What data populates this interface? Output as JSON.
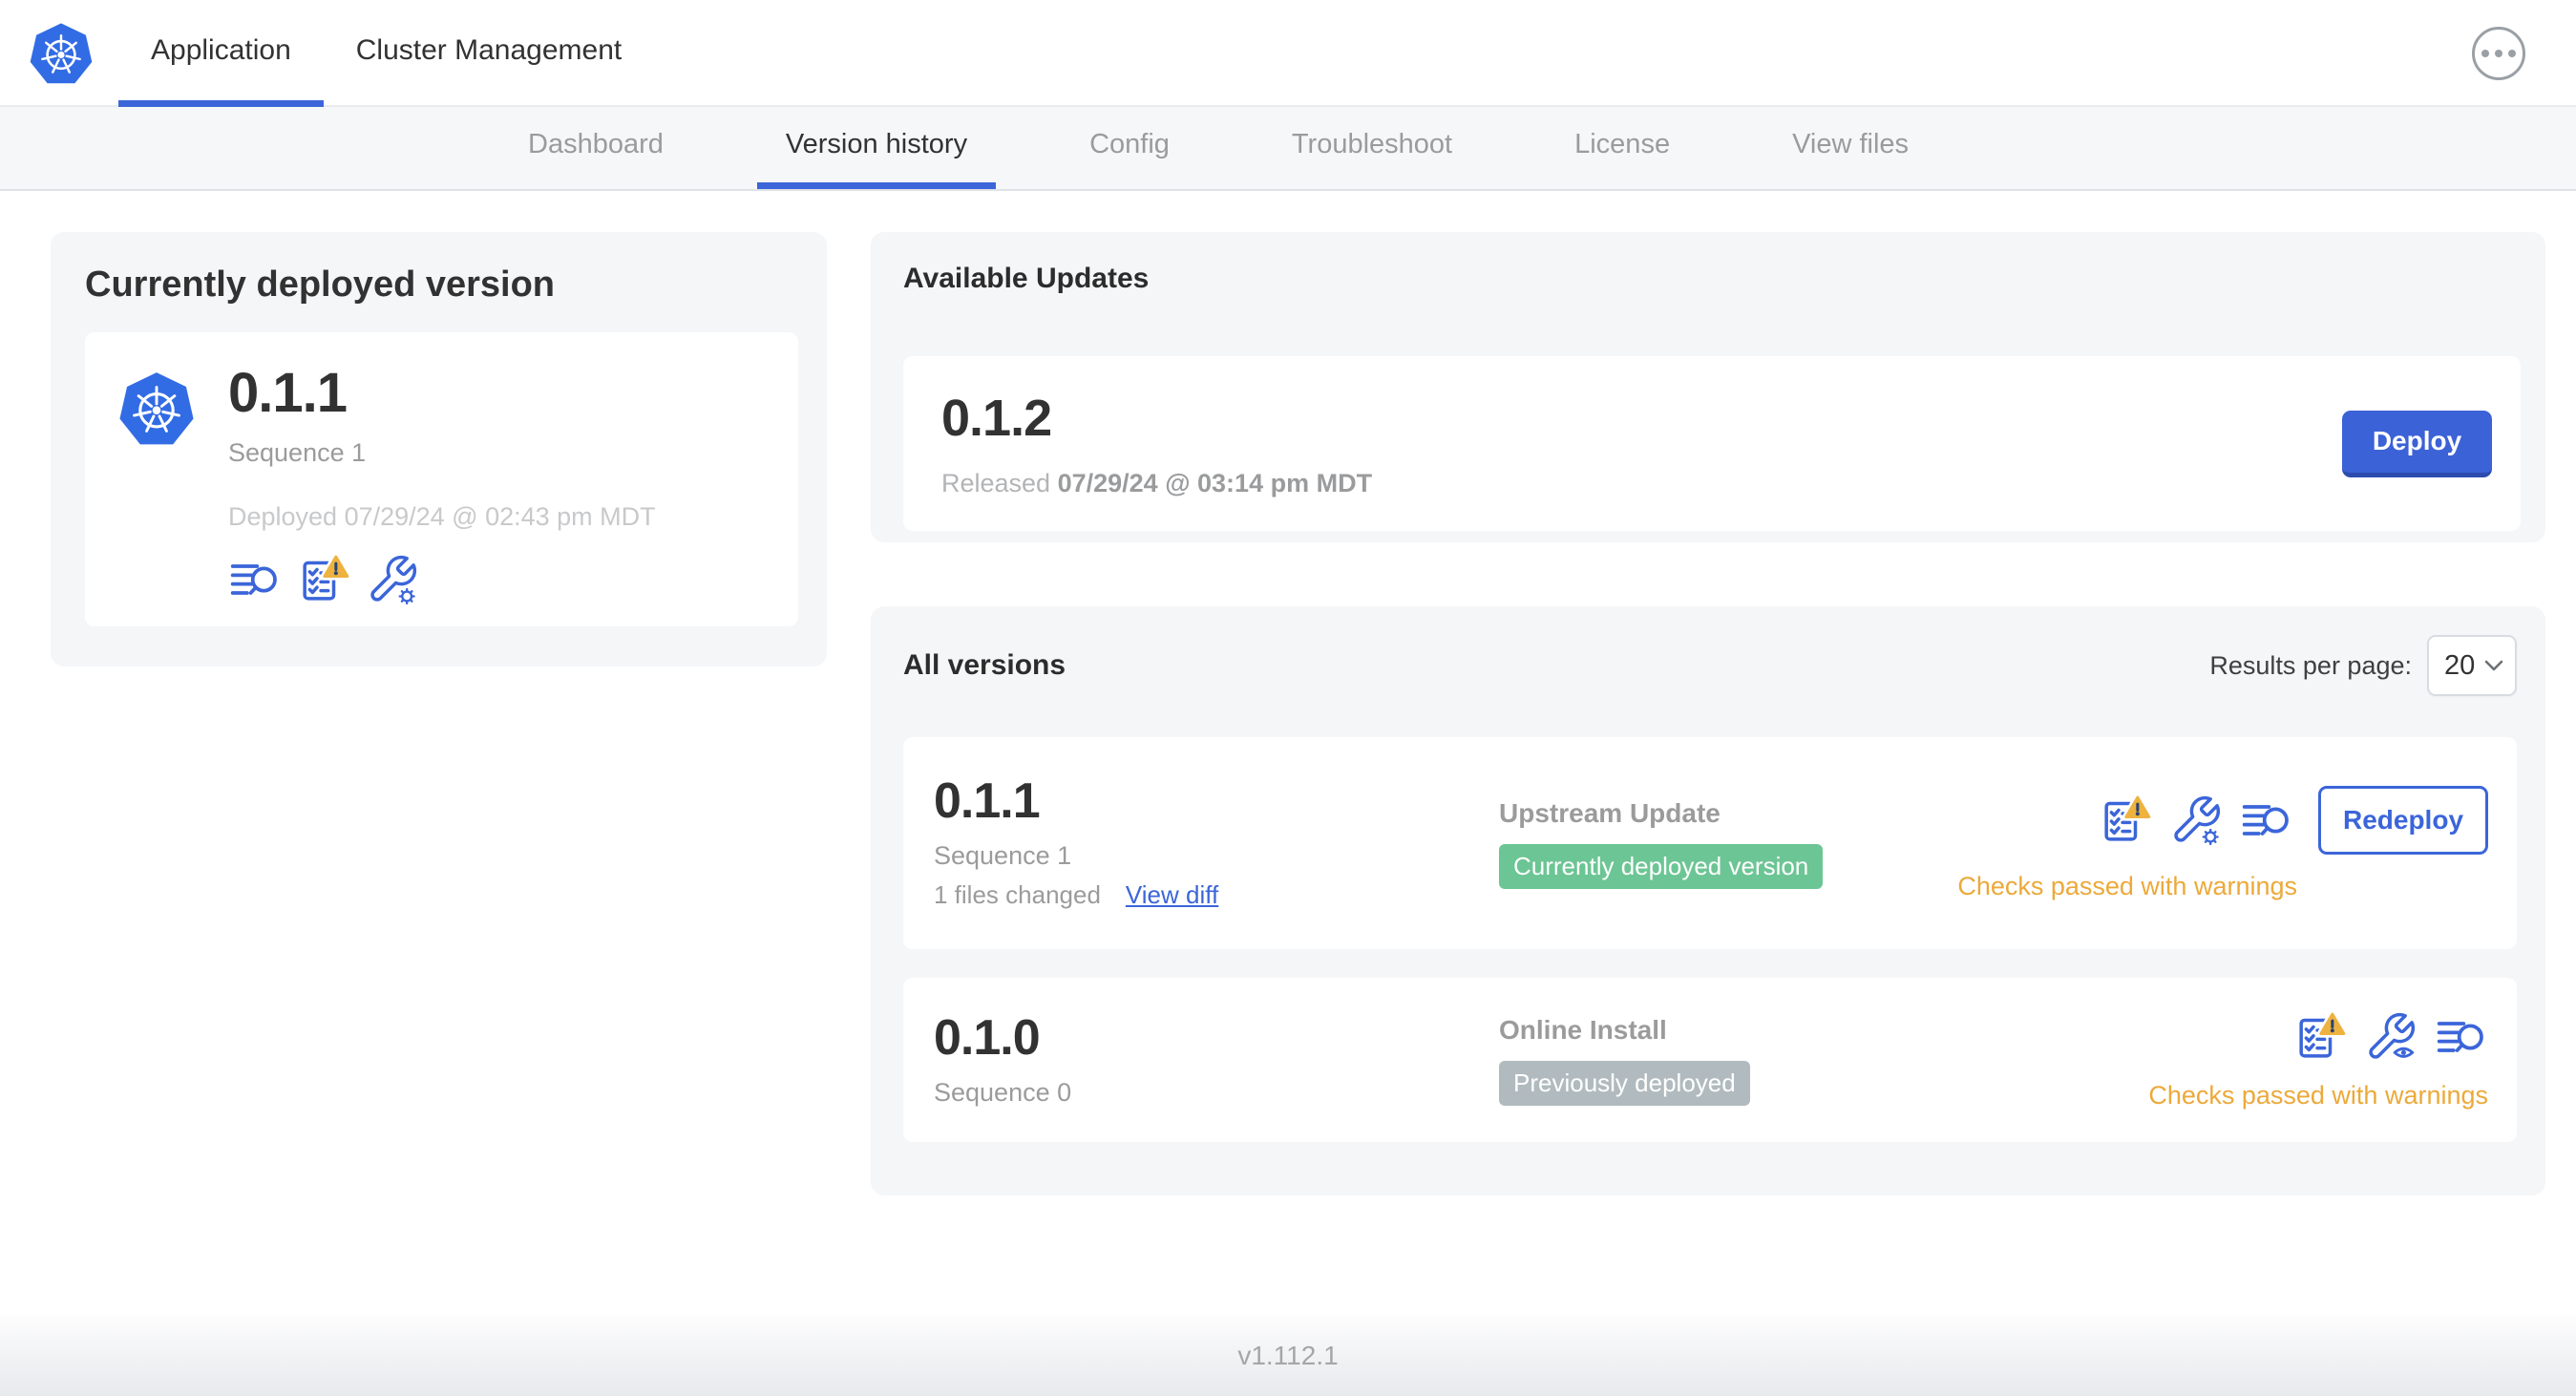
{
  "colors": {
    "accent_blue": "#3b65d9",
    "kubernetes_blue": "#326ce5",
    "badge_green": "#6cc594",
    "badge_gray": "#b1bbbf",
    "warning_amber": "#eca93a"
  },
  "topbar": {
    "tabs": [
      {
        "label": "Application",
        "active": true
      },
      {
        "label": "Cluster Management",
        "active": false
      }
    ],
    "more_icon": "ellipsis-icon"
  },
  "nav": {
    "items": [
      {
        "label": "Dashboard",
        "active": false
      },
      {
        "label": "Version history",
        "active": true
      },
      {
        "label": "Config",
        "active": false
      },
      {
        "label": "Troubleshoot",
        "active": false
      },
      {
        "label": "License",
        "active": false
      },
      {
        "label": "View files",
        "active": false
      }
    ]
  },
  "current_version": {
    "title": "Currently deployed version",
    "version": "0.1.1",
    "sequence": "Sequence 1",
    "deployed": "Deployed 07/29/24 @ 02:43 pm MDT",
    "icons": [
      "release-notes-icon",
      "preflight-checks-warning-icon",
      "config-edit-icon"
    ]
  },
  "available_updates": {
    "title": "Available Updates",
    "version": "0.1.2",
    "released_prefix": "Released",
    "released_date": "07/29/24 @ 03:14 pm MDT",
    "deploy_label": "Deploy"
  },
  "all_versions": {
    "title": "All versions",
    "results_per_page_label": "Results per page:",
    "results_per_page_value": "20",
    "rows": [
      {
        "version": "0.1.1",
        "sequence": "Sequence 1",
        "files_changed": "1 files changed",
        "view_diff_label": "View diff",
        "source": "Upstream Update",
        "badge_label": "Currently deployed version",
        "badge_type": "green",
        "icons": [
          "preflight-checks-warning-icon",
          "config-edit-icon",
          "release-notes-icon"
        ],
        "action_label": "Redeploy",
        "status_text": "Checks passed with warnings"
      },
      {
        "version": "0.1.0",
        "sequence": "Sequence 0",
        "source": "Online Install",
        "badge_label": "Previously deployed",
        "badge_type": "gray",
        "icons": [
          "preflight-checks-warning-icon",
          "config-view-icon",
          "release-notes-icon"
        ],
        "status_text": "Checks passed with warnings"
      }
    ]
  },
  "footer": {
    "app_version": "v1.112.1"
  }
}
